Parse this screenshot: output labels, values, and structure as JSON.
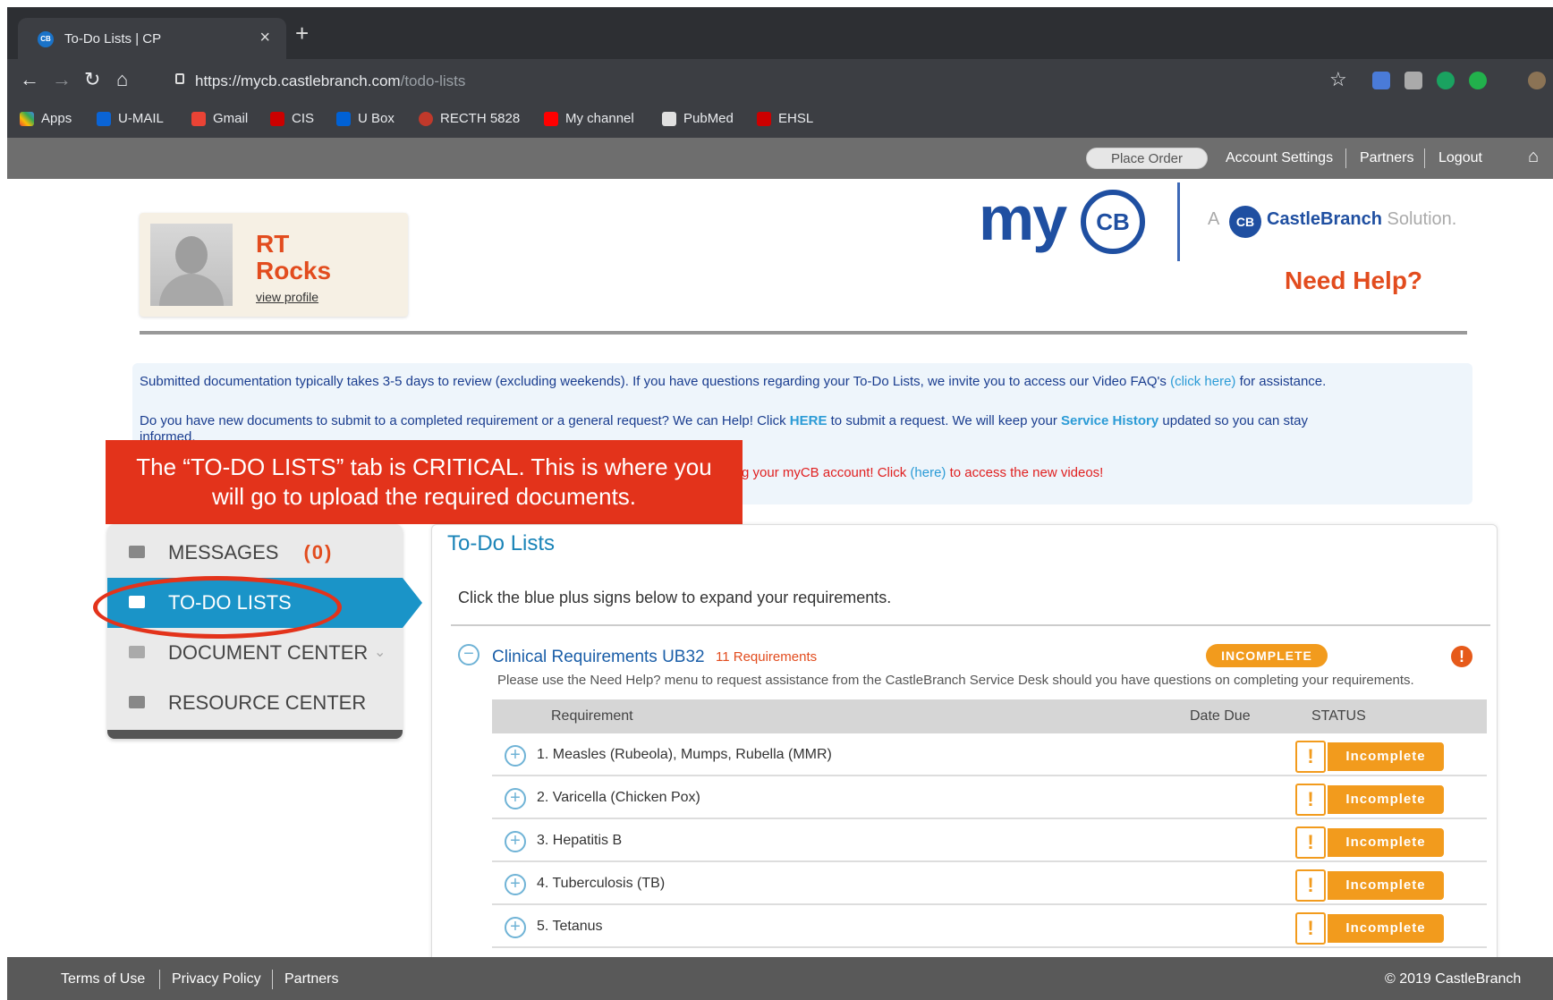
{
  "browser": {
    "tab_title": "To-Do Lists | CP",
    "url_host": "https://mycb.castlebranch.com",
    "url_path": "/todo-lists",
    "bookmarks": [
      "Apps",
      "U-MAIL",
      "Gmail",
      "CIS",
      "U Box",
      "RECTH 5828",
      "My channel",
      "PubMed",
      "EHSL"
    ]
  },
  "site_nav": {
    "place_order": "Place Order",
    "account_settings": "Account Settings",
    "partners": "Partners",
    "logout": "Logout"
  },
  "profile": {
    "first": "RT",
    "last": "Rocks",
    "view_profile": "view profile"
  },
  "brand": {
    "logo_my": "my",
    "logo_cb": "CB",
    "a": "A",
    "cb_icon": "CB",
    "castlebranch": "CastleBranch",
    "solution": "Solution.",
    "need_help": "Need Help?"
  },
  "notice": {
    "line1_a": "Submitted documentation typically takes 3-5 days to review (excluding weekends). If you have questions regarding your To-Do Lists, we invite you to access our Video FAQ's",
    "line1_link": "(click here)",
    "line1_b": "for assistance.",
    "line2_a": "Do you have new documents to submit to a completed requirement or a general request? We can Help! Click",
    "line2_here": "HERE",
    "line2_b": "to submit a request. We will keep your",
    "line2_service": "Service History",
    "line2_c": "updated so you can stay",
    "line2_d": "informed.",
    "line3_a": "g your myCB account! Click",
    "line3_link": "(here)",
    "line3_b": "to access the new videos!"
  },
  "callout": {
    "line1": "The “TO-DO LISTS” tab is CRITICAL. This is where you",
    "line2": "will go to upload the required documents."
  },
  "sidebar": {
    "messages": "MESSAGES",
    "messages_count": "(0)",
    "todo": "TO-DO LISTS",
    "document_center": "DOCUMENT CENTER",
    "resource_center": "RESOURCE CENTER"
  },
  "main": {
    "title": "To-Do Lists",
    "subtitle": "Click the blue plus signs below to expand your requirements.",
    "section_title": "Clinical Requirements UB32",
    "section_count": "11 Requirements",
    "section_status": "INCOMPLETE",
    "section_desc": "Please use the Need Help? menu to request assistance from the CastleBranch Service Desk should you have questions on completing your requirements.",
    "col_requirement": "Requirement",
    "col_date_due": "Date Due",
    "col_status": "STATUS",
    "rows": [
      {
        "label": "1. Measles (Rubeola), Mumps, Rubella (MMR)",
        "status": "Incomplete"
      },
      {
        "label": "2. Varicella (Chicken Pox)",
        "status": "Incomplete"
      },
      {
        "label": "3. Hepatitis B",
        "status": "Incomplete"
      },
      {
        "label": "4. Tuberculosis (TB)",
        "status": "Incomplete"
      },
      {
        "label": "5. Tetanus",
        "status": "Incomplete"
      }
    ]
  },
  "footer": {
    "terms": "Terms of Use",
    "privacy": "Privacy Policy",
    "partners": "Partners",
    "copyright": "© 2019 CastleBranch"
  },
  "colors": {
    "accent_blue": "#1a94c8",
    "brand_orange": "#e24c1e",
    "status_orange": "#f29b1d",
    "callout_red": "#e3331b"
  }
}
